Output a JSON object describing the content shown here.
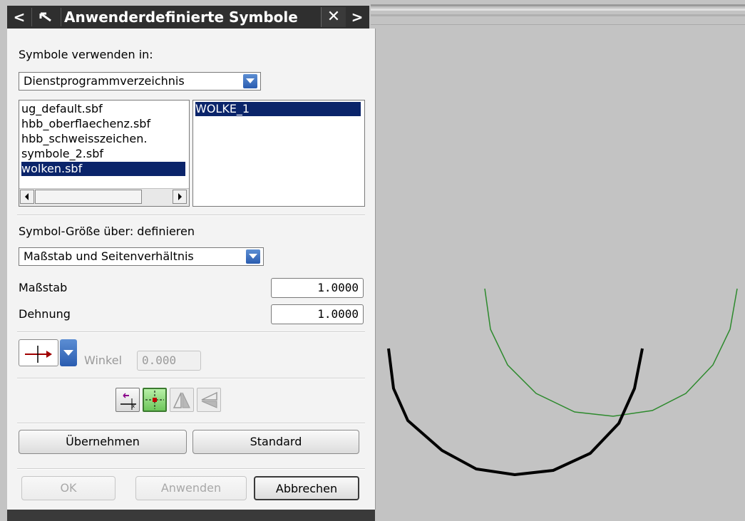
{
  "dialog": {
    "title": "Anwenderdefinierte Symbole",
    "nav_prev": "<",
    "nav_next": ">",
    "close_glyph": "✕"
  },
  "symbols_in": {
    "label": "Symbole verwenden in:",
    "selected": "Dienstprogrammverzeichnis"
  },
  "files": {
    "items": [
      "ug_default.sbf",
      "hbb_oberflaechenz.sbf",
      "hbb_schweisszeichen.",
      "symbole_2.sbf",
      "wolken.sbf"
    ],
    "selected_index": 4
  },
  "symbols": {
    "items": [
      "WOLKE_1"
    ],
    "selected_index": 0
  },
  "size_def": {
    "label": "Symbol-Größe über: definieren",
    "selected": "Maßstab und Seitenverhältnis"
  },
  "scale": {
    "label": "Maßstab",
    "value": "1.0000"
  },
  "stretch": {
    "label": "Dehnung",
    "value": "1.0000"
  },
  "angle": {
    "label": "Winkel",
    "value": "0.000"
  },
  "buttons": {
    "apply_settings": "Übernehmen",
    "standard": "Standard",
    "ok": "OK",
    "apply": "Anwenden",
    "cancel": "Abbrechen"
  },
  "colors": {
    "selection": "#0a246a",
    "cloud_preview": "#2d8a2d",
    "cloud_placed": "#000000",
    "viewport_bg": "#c3c3c3"
  }
}
